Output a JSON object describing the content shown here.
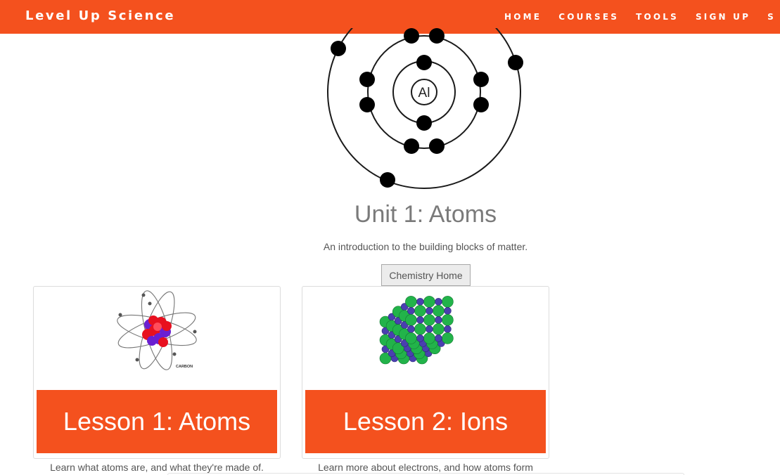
{
  "navbar": {
    "brand": "Level Up Science",
    "links": [
      "HOME",
      "COURSES",
      "TOOLS",
      "SIGN UP",
      "S"
    ],
    "background": "#f4511e"
  },
  "hero": {
    "element_symbol": "Al",
    "title": "Unit 1: Atoms",
    "subtitle": "An introduction to the building blocks of matter.",
    "button_label": "Chemistry Home"
  },
  "lessons": [
    {
      "title": "Lesson 1: Atoms",
      "image_caption": "CARBON",
      "description": "Learn what atoms are, and what they're made of."
    },
    {
      "title": "Lesson 2: Ions",
      "description": "Learn more about electrons, and how atoms form"
    }
  ]
}
